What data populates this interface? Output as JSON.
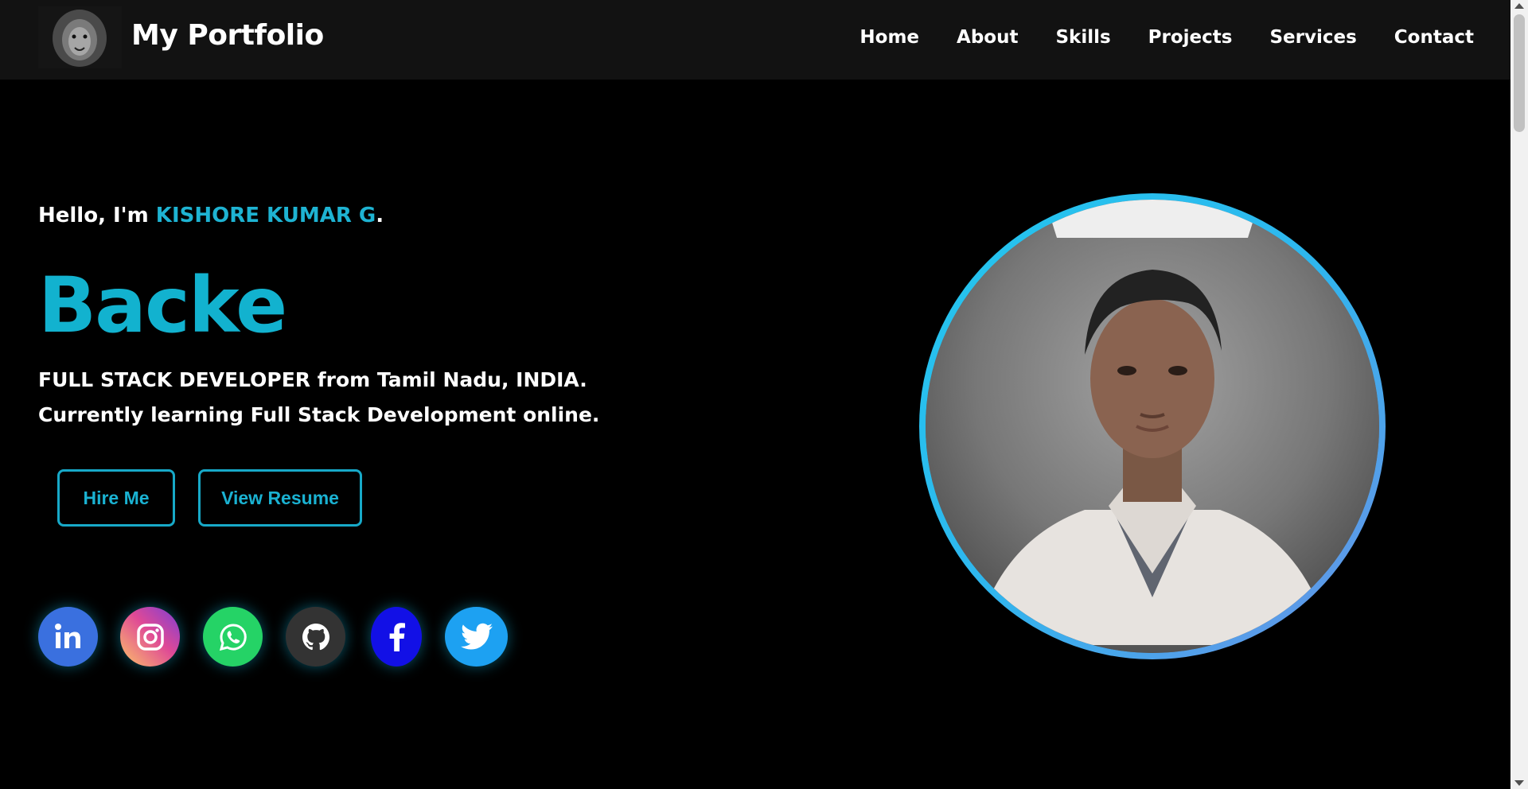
{
  "nav": {
    "brand": "My Portfolio",
    "links": [
      "Home",
      "About",
      "Skills",
      "Projects",
      "Services",
      "Contact"
    ]
  },
  "hero": {
    "greeting_prefix": "Hello, I'm ",
    "name": "KISHORE KUMAR G",
    "greeting_suffix": ".",
    "typed_text": "Backe",
    "line1": "FULL STACK DEVELOPER from Tamil Nadu, INDIA.",
    "line2": "Currently learning Full Stack Development online.",
    "hire_label": "Hire Me",
    "resume_label": "View Resume"
  },
  "social": [
    {
      "name": "linkedin-icon",
      "color": "#3a70df"
    },
    {
      "name": "instagram-icon",
      "color": "#df4996"
    },
    {
      "name": "whatsapp-icon",
      "color": "#25d366"
    },
    {
      "name": "github-icon",
      "color": "#333333"
    },
    {
      "name": "facebook-icon",
      "color": "#1210e6"
    },
    {
      "name": "twitter-icon",
      "color": "#1da1f2"
    }
  ],
  "colors": {
    "accent": "#1eb3d2",
    "nav_bg": "#121212",
    "page_bg": "#000000"
  }
}
